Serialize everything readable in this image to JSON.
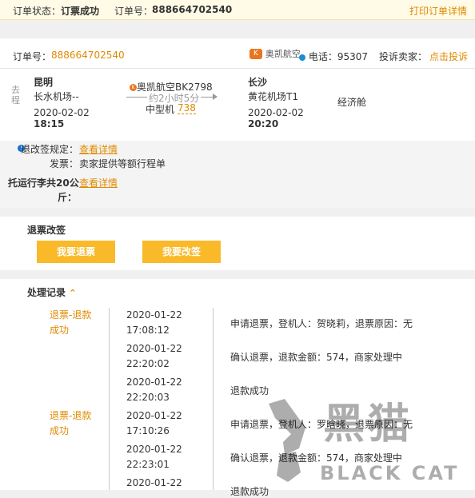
{
  "status_bar": {
    "status_label": "订单状态：",
    "status_value": "订票成功",
    "order_label": "订单号：",
    "order_number": "888664702540",
    "print_link": "打印订单详情"
  },
  "order_header": {
    "order_label": "订单号：",
    "order_number": "888664702540",
    "airline_logo_text": "奥凯航空",
    "phone_label": "电话：",
    "phone": "95307",
    "complain_label": "投诉卖家：",
    "complain_link": "点击投诉"
  },
  "flight": {
    "leg_label": "去程",
    "departure_city": "昆明",
    "departure_airport": "长水机场--",
    "departure_date": "2020-02-02",
    "departure_time": "18:15",
    "airline_flight": "奥凯航空BK2798",
    "duration": "约2小时5分",
    "aircraft_type": "中型机",
    "aircraft_code": "738",
    "arrival_city": "长沙",
    "arrival_airport": "黄花机场T1",
    "arrival_date": "2020-02-02",
    "arrival_time": "20:20",
    "cabin": "经济舱"
  },
  "extras": {
    "policy_label": "退改签规定：",
    "policy_link": "查看详情",
    "invoice_label": "发票：",
    "invoice_value": "卖家提供等额行程单",
    "baggage_label_line1": "托运行李共20公",
    "baggage_label_line2": "斤：",
    "baggage_link": "查看详情"
  },
  "refund": {
    "title": "退票改签",
    "refund_button": "我要退票",
    "change_button": "我要改签"
  },
  "records": {
    "title": "处理记录",
    "groups": [
      {
        "status_line1": "退票-退款",
        "status_line2": "成功"
      },
      {
        "status_line1": "退票-退款",
        "status_line2": "成功"
      }
    ],
    "entries": [
      {
        "date": "2020-01-22",
        "time": "17:08:12",
        "desc": "申请退票，登机人：贺晓莉，退票原因：无"
      },
      {
        "date": "2020-01-22",
        "time": "22:20:02",
        "desc": "确认退票，退款金额：574，商家处理中"
      },
      {
        "date": "2020-01-22",
        "time": "22:20:03",
        "desc": "退款成功"
      },
      {
        "date": "2020-01-22",
        "time": "17:10:26",
        "desc": "申请退票，登机人：罗晗晓，退票原因：无"
      },
      {
        "date": "2020-01-22",
        "time": "22:23:01",
        "desc": "确认退票，退款金额：574，商家处理中"
      },
      {
        "date": "2020-01-22",
        "time": "",
        "desc": "退款成功"
      }
    ]
  },
  "watermark": {
    "cn_text": "黑猫",
    "en_text": "BLACK CAT"
  },
  "colors": {
    "accent_orange": "#e08a00",
    "button_yellow": "#f9b928",
    "status_bar_bg": "#fffbe6",
    "page_bg": "#f0f0f0"
  }
}
